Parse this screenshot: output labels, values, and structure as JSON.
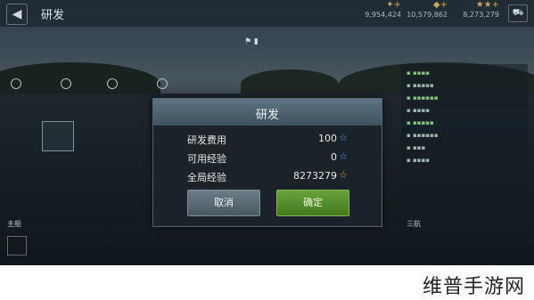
{
  "header": {
    "back_icon": "back-arrow-icon",
    "title": "研发",
    "resources": [
      {
        "icon": "credits-icon",
        "value": "9,954,424"
      },
      {
        "icon": "gold-icon",
        "value": "10,579,862"
      },
      {
        "icon": "xp-stars-icon",
        "value": "8,273,279"
      }
    ],
    "cart_icon": "shop-cart-icon"
  },
  "dialog": {
    "title": "研发",
    "rows": [
      {
        "label": "研发费用",
        "value": "100",
        "star_color": "#5aa0e8"
      },
      {
        "label": "可用经验",
        "value": "0",
        "star_color": "#5aa0e8"
      },
      {
        "label": "全局经验",
        "value": "8273279",
        "star_color": "#e0b04a"
      }
    ],
    "cancel_label": "取消",
    "confirm_label": "确定"
  },
  "side": {
    "bottom_labels": [
      "",
      "",
      "三航"
    ]
  },
  "left": {
    "bottom_label": "主船"
  },
  "watermark": "维普手游网",
  "colors": {
    "confirm": "#4f8c28",
    "cancel": "#5b6a73",
    "header": "#4e6471"
  }
}
